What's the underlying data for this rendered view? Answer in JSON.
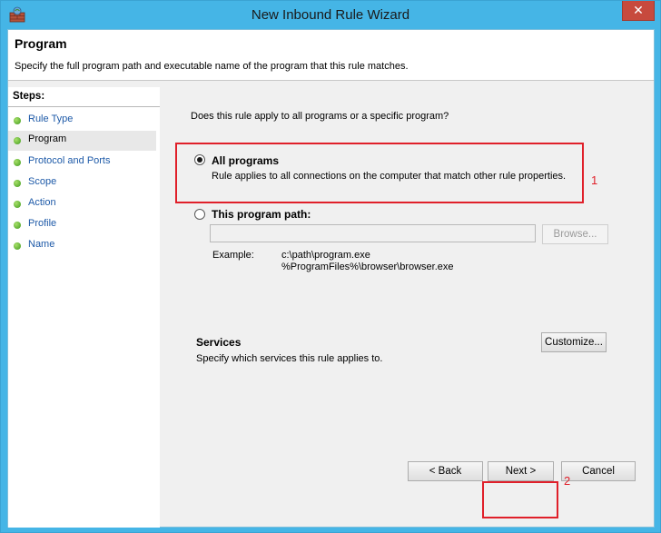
{
  "window": {
    "title": "New Inbound Rule Wizard",
    "close_symbol": "✕"
  },
  "header": {
    "title": "Program",
    "description": "Specify the full program path and executable name of the program that this rule matches."
  },
  "steps": {
    "heading": "Steps:",
    "items": [
      {
        "label": "Rule Type"
      },
      {
        "label": "Program"
      },
      {
        "label": "Protocol and Ports"
      },
      {
        "label": "Scope"
      },
      {
        "label": "Action"
      },
      {
        "label": "Profile"
      },
      {
        "label": "Name"
      }
    ],
    "selected": "Program"
  },
  "main": {
    "question": "Does this rule apply to all programs or a specific program?",
    "all_programs": {
      "label": "All programs",
      "description": "Rule applies to all connections on the computer that match other rule properties.",
      "checked": true
    },
    "program_path": {
      "label": "This program path:",
      "value": "",
      "checked": false,
      "browse_label": "Browse..."
    },
    "example": {
      "label": "Example:",
      "line1": "c:\\path\\program.exe",
      "line2": "%ProgramFiles%\\browser\\browser.exe"
    },
    "services": {
      "title": "Services",
      "description": "Specify which services this rule applies to.",
      "customize_label": "Customize..."
    }
  },
  "footer": {
    "back_label": "< Back",
    "next_label": "Next >",
    "cancel_label": "Cancel"
  },
  "annotations": {
    "marker1": "1",
    "marker2": "2",
    "color": "#e0202a"
  },
  "colors": {
    "title_bar": "#45b5e6",
    "close_button": "#c74a3d",
    "step_link": "#1e5aa8",
    "step_dot": "#3f9a1c"
  }
}
